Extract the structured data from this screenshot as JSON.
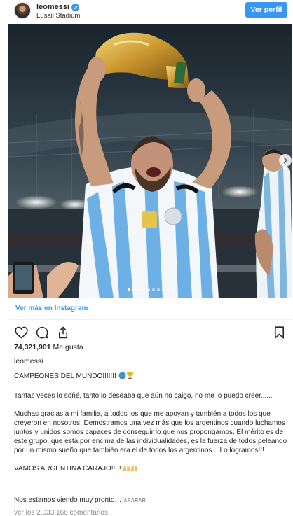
{
  "header": {
    "username": "leomessi",
    "location": "Lusail Stadium",
    "profile_button": "Ver perfil"
  },
  "post": {
    "see_more_link": "Ver más en Instagram",
    "likes": "74,321,901",
    "likes_label": "Me gusta",
    "owner": "leomessi",
    "carousel": {
      "dots": 10,
      "active_index": 0
    }
  },
  "caption": {
    "p1": "CAMPEONES DEL MUNDO!!!!!!!",
    "p2": "Tantas veces lo soñé, tanto lo deseaba que aún no caigo, no me lo puedo creer......",
    "p3": "Muchas gracias a mi familia, a todos los que me apoyan y también a todos los que creyeron en nosotros. Demostramos una vez más que los argentinos cuando luchamos juntos y unidos somos capaces de conseguir lo que nos propongamos. El mérito es de este grupo, que está por encima de las individualidades, es la fuerza de todos peleando por un mismo sueño que también era el de todos los argentinos... Lo logramos!!!",
    "p4": "VAMOS ARGENTINA CARAJO!!!!!",
    "more_text": "Nos estamos viendo muy pronto…",
    "more_link": "ARARAR",
    "comments": "ver los 2,033,166 comentarios"
  },
  "colors": {
    "accent": "#3897f0",
    "text": "#262626",
    "muted": "#8e8e8e",
    "border": "#dbdbdb"
  },
  "icons": [
    "verified-badge-icon",
    "heart-icon",
    "comment-icon",
    "share-icon",
    "bookmark-icon",
    "carousel-next-icon",
    "globe-emoji",
    "trophy-emoji",
    "raised-hands-emoji"
  ]
}
